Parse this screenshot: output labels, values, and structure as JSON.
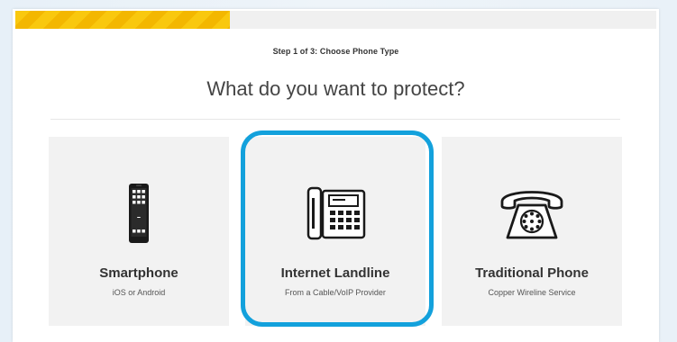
{
  "progress": {
    "fraction": 0.335,
    "fill_color": "#f9c80e"
  },
  "step_label": "Step 1 of 3: Choose Phone Type",
  "heading": "What do you want to protect?",
  "options": [
    {
      "title": "Smartphone",
      "subtitle": "iOS or Android",
      "icon": "smartphone-icon"
    },
    {
      "title": "Internet Landline",
      "subtitle": "From a Cable/VoIP Provider",
      "icon": "desk-phone-icon",
      "highlighted": true
    },
    {
      "title": "Traditional Phone",
      "subtitle": "Copper Wireline Service",
      "icon": "rotary-phone-icon"
    }
  ],
  "colors": {
    "highlight": "#13a1dc",
    "option_bg": "#f2f2f2",
    "text": "#333333"
  }
}
